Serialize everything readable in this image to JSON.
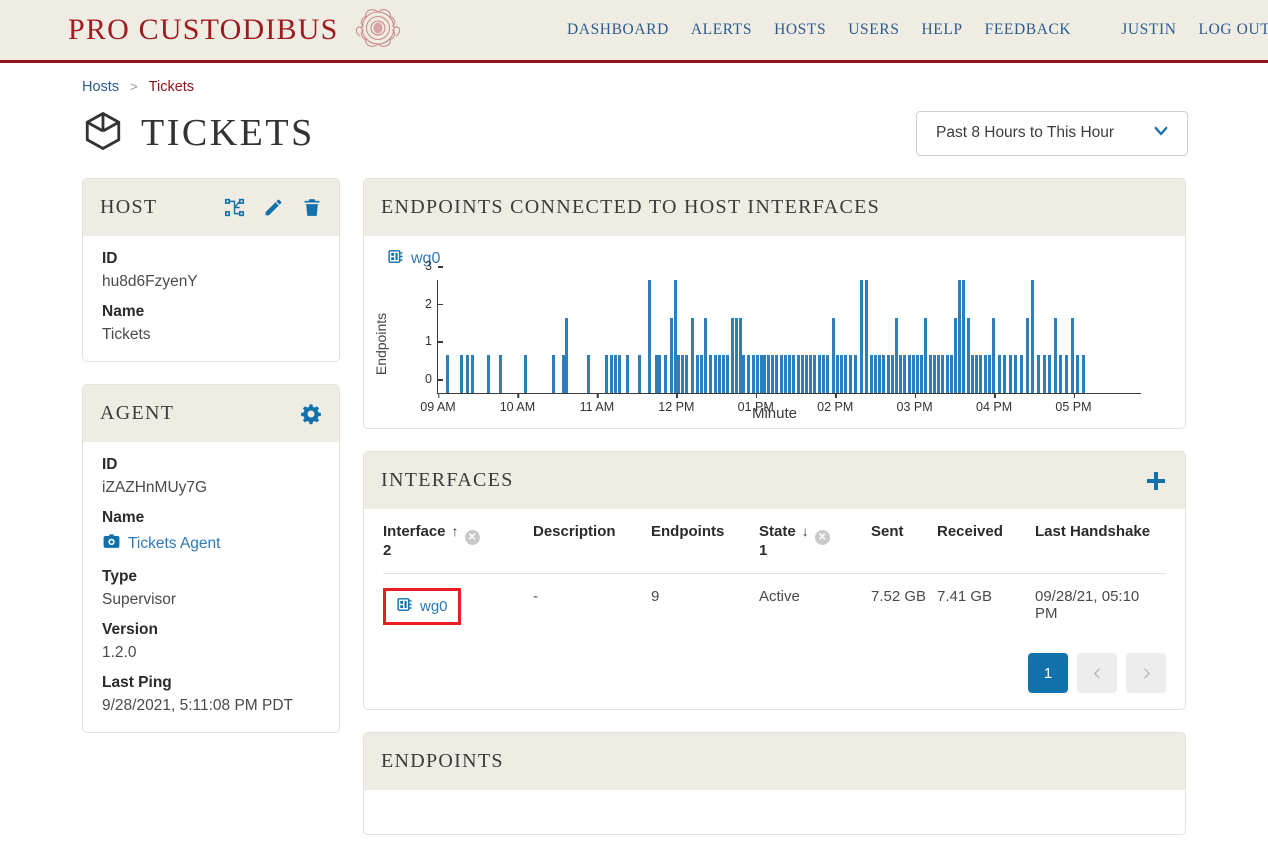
{
  "brand": {
    "name": "PRO CUSTODIBUS",
    "logo_icon": "medusa-logo"
  },
  "nav": {
    "items": [
      {
        "label": "DASHBOARD",
        "name": "dashboard"
      },
      {
        "label": "ALERTS",
        "name": "alerts"
      },
      {
        "label": "HOSTS",
        "name": "hosts"
      },
      {
        "label": "USERS",
        "name": "users"
      },
      {
        "label": "HELP",
        "name": "help"
      },
      {
        "label": "FEEDBACK",
        "name": "feedback"
      }
    ],
    "user": "JUSTIN",
    "logout": "LOG OUT"
  },
  "breadcrumb": {
    "parent": "Hosts",
    "separator": ">",
    "current": "Tickets"
  },
  "page": {
    "title": "TICKETS",
    "title_icon": "cube-icon",
    "range_value": "Past 8 Hours to This Hour",
    "range_icon": "chevron-down-icon"
  },
  "host_card": {
    "title": "HOST",
    "actions": [
      {
        "name": "network-graph-icon"
      },
      {
        "name": "edit-pencil-icon"
      },
      {
        "name": "trash-delete-icon"
      }
    ],
    "fields": [
      {
        "label": "ID",
        "value": "hu8d6FzyenY"
      },
      {
        "label": "Name",
        "value": "Tickets"
      }
    ]
  },
  "agent_card": {
    "title": "AGENT",
    "settings_icon": "gear-icon",
    "id_label": "ID",
    "id_value": "iZAZHnMUy7G",
    "name_label": "Name",
    "name_value": "Tickets Agent",
    "name_icon": "agent-icon",
    "type_label": "Type",
    "type_value": "Supervisor",
    "version_label": "Version",
    "version_value": "1.2.0",
    "last_ping_label": "Last Ping",
    "last_ping_value": "9/28/2021, 5:11:08 PM PDT"
  },
  "chart_card": {
    "title": "ENDPOINTS CONNECTED TO HOST INTERFACES",
    "interface_label": "wg0",
    "interface_icon": "interface-chip-icon"
  },
  "chart_data": {
    "type": "bar",
    "title": "ENDPOINTS CONNECTED TO HOST INTERFACES",
    "series_name": "wg0",
    "xlabel": "Minute",
    "ylabel": "Endpoints",
    "ylim": [
      0,
      3
    ],
    "yticks": [
      0,
      1,
      2,
      3
    ],
    "grid": false,
    "xticks": [
      "09 AM",
      "10 AM",
      "11 AM",
      "12 PM",
      "01 PM",
      "02 PM",
      "03 PM",
      "04 PM",
      "05 PM"
    ],
    "xtick_positions": [
      0.0,
      0.113,
      0.226,
      0.339,
      0.452,
      0.565,
      0.678,
      0.791,
      0.904
    ],
    "x": [
      0.012,
      0.031,
      0.04,
      0.047,
      0.07,
      0.087,
      0.123,
      0.162,
      0.176,
      0.18,
      0.212,
      0.237,
      0.244,
      0.25,
      0.256,
      0.268,
      0.285,
      0.299,
      0.309,
      0.313,
      0.322,
      0.33,
      0.336,
      0.34,
      0.345,
      0.352,
      0.36,
      0.367,
      0.372,
      0.379,
      0.386,
      0.392,
      0.398,
      0.404,
      0.41,
      0.417,
      0.423,
      0.428,
      0.433,
      0.44,
      0.446,
      0.452,
      0.458,
      0.463,
      0.468,
      0.474,
      0.48,
      0.486,
      0.492,
      0.498,
      0.504,
      0.51,
      0.516,
      0.522,
      0.528,
      0.534,
      0.54,
      0.546,
      0.552,
      0.56,
      0.566,
      0.572,
      0.578,
      0.585,
      0.592,
      0.6,
      0.608,
      0.614,
      0.62,
      0.626,
      0.632,
      0.638,
      0.644,
      0.65,
      0.656,
      0.662,
      0.668,
      0.674,
      0.68,
      0.686,
      0.692,
      0.698,
      0.704,
      0.71,
      0.716,
      0.722,
      0.728,
      0.734,
      0.74,
      0.746,
      0.752,
      0.758,
      0.764,
      0.77,
      0.776,
      0.782,
      0.788,
      0.796,
      0.804,
      0.812,
      0.82,
      0.828,
      0.836,
      0.844,
      0.852,
      0.86,
      0.868,
      0.876,
      0.884,
      0.892,
      0.9,
      0.908,
      0.916
    ],
    "values": [
      1,
      1,
      1,
      1,
      1,
      1,
      1,
      1,
      1,
      2,
      1,
      1,
      1,
      1,
      1,
      1,
      1,
      3,
      1,
      1,
      1,
      2,
      3,
      1,
      1,
      1,
      2,
      1,
      1,
      2,
      1,
      1,
      1,
      1,
      1,
      2,
      2,
      2,
      1,
      1,
      1,
      1,
      1,
      1,
      1,
      1,
      1,
      1,
      1,
      1,
      1,
      1,
      1,
      1,
      1,
      1,
      1,
      1,
      1,
      2,
      1,
      1,
      1,
      1,
      1,
      3,
      3,
      1,
      1,
      1,
      1,
      1,
      1,
      2,
      1,
      1,
      1,
      1,
      1,
      1,
      2,
      1,
      1,
      1,
      1,
      1,
      1,
      2,
      3,
      3,
      2,
      1,
      1,
      1,
      1,
      1,
      2,
      1,
      1,
      1,
      1,
      1,
      2,
      3,
      1,
      1,
      1,
      2,
      1,
      1,
      2,
      1,
      1,
      1
    ]
  },
  "interfaces_card": {
    "title": "INTERFACES",
    "add_icon": "plus-add-icon",
    "columns": [
      {
        "label": "Interface",
        "sort": "↑",
        "rank": "2",
        "removable": true
      },
      {
        "label": "Description",
        "sort": "",
        "rank": "",
        "removable": false
      },
      {
        "label": "Endpoints",
        "sort": "",
        "rank": "",
        "removable": false
      },
      {
        "label": "State",
        "sort": "↓",
        "rank": "1",
        "removable": true
      },
      {
        "label": "Sent",
        "sort": "",
        "rank": "",
        "removable": false
      },
      {
        "label": "Received",
        "sort": "",
        "rank": "",
        "removable": false
      },
      {
        "label": "Last Handshake",
        "sort": "",
        "rank": "",
        "removable": false
      }
    ],
    "rows": [
      {
        "interface": "wg0",
        "interface_icon": "interface-chip-icon",
        "highlighted": true,
        "description": "-",
        "endpoints": "9",
        "state": "Active",
        "sent": "7.52 GB",
        "received": "7.41 GB",
        "last_handshake": "09/28/21, 05:10 PM"
      }
    ],
    "pagination": {
      "current": "1",
      "prev_icon": "chevron-left-icon",
      "next_icon": "chevron-right-icon"
    }
  },
  "endpoints_card": {
    "title": "ENDPOINTS"
  },
  "colors": {
    "brand_red": "#9e1b20",
    "nav_blue": "#2d5b8e",
    "link_blue": "#2d79b8",
    "accent_blue": "#1172ab",
    "header_bg": "#efede3",
    "active_green": "#2e8b3d",
    "bar_blue": "#2e7ebb",
    "highlight_red": "#ec1c24"
  }
}
